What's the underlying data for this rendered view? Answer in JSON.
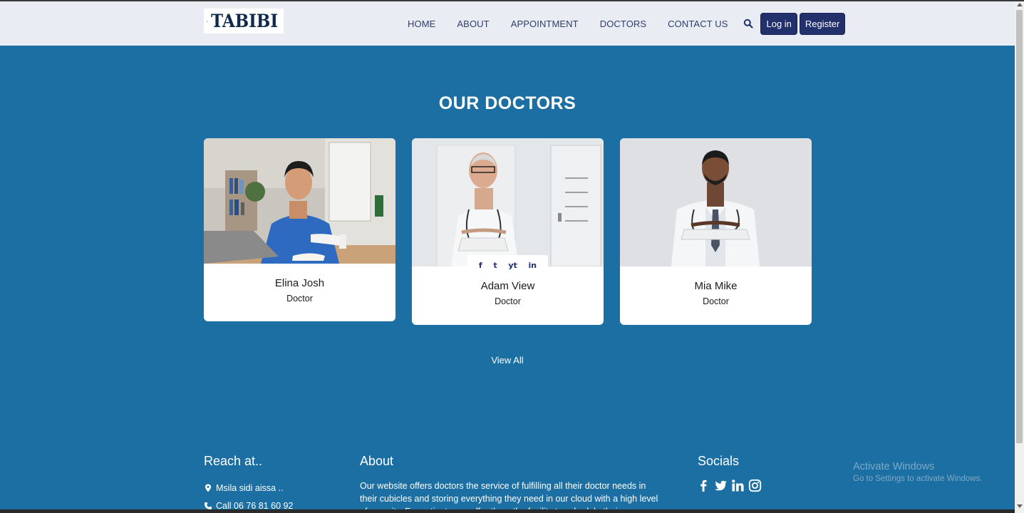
{
  "brand": {
    "name": "TABIBI"
  },
  "nav": {
    "items": [
      "HOME",
      "ABOUT",
      "APPOINTMENT",
      "DOCTORS",
      "CONTACT US"
    ],
    "login_label": "Log in",
    "register_label": "Register"
  },
  "doctors_section": {
    "title": "OUR DOCTORS",
    "view_all_label": "View All",
    "doctors": [
      {
        "name": "Elina Josh",
        "role": "Doctor"
      },
      {
        "name": "Adam View",
        "role": "Doctor"
      },
      {
        "name": "Mia Mike",
        "role": "Doctor"
      }
    ],
    "social_labels": [
      "f",
      "t",
      "yt",
      "in"
    ]
  },
  "footer": {
    "reach": {
      "title": "Reach at..",
      "address": "Msila sidi aissa ..",
      "phone": "Call 06 76 81 60 92"
    },
    "about": {
      "title": "About",
      "text": "Our website offers doctors the service of fulfilling all their doctor needs in their cubicles and storing everything they need in our cloud with a high level of security. For patients, we offer them the facility to schedule their"
    },
    "socials": {
      "title": "Socials"
    }
  },
  "os_overlay": {
    "line1": "Activate Windows",
    "line2": "Go to Settings to activate Windows."
  },
  "colors": {
    "page_bg": "#1b6fa3",
    "header_bg": "#e9edf3",
    "nav_text": "#2c3e6b",
    "button_bg": "#22306b",
    "brand_text": "#102a4c"
  }
}
